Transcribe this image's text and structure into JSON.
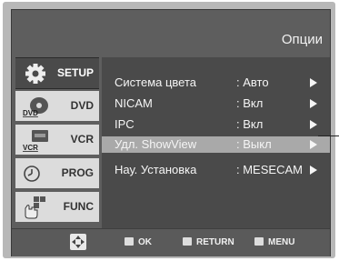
{
  "header": {
    "title": "Опции"
  },
  "sidebar": {
    "items": [
      {
        "label": "SETUP",
        "icon": "gear-icon",
        "active": true
      },
      {
        "label": "DVD",
        "icon": "dvd-disc-icon",
        "icon_text": "DVD"
      },
      {
        "label": "VCR",
        "icon": "vcr-cassette-icon",
        "icon_text": "VCR"
      },
      {
        "label": "PROG",
        "icon": "clock-icon"
      },
      {
        "label": "FUNC",
        "icon": "hand-pointer-icon"
      }
    ]
  },
  "menu": {
    "rows": [
      {
        "name": "Система цвета",
        "value": ": Авто"
      },
      {
        "name": "NICAM",
        "value": ": Вкл"
      },
      {
        "name": "IPC",
        "value": ": Вкл"
      },
      {
        "name": "Удл. ShowView",
        "value": ": Выкл",
        "selected": true
      },
      {
        "name": "Нау. Установка",
        "value": ": MESECAM"
      }
    ]
  },
  "footer": {
    "nav_icon": "dpad-icon",
    "ok_label": "OK",
    "return_label": "RETURN",
    "menu_label": "MENU"
  },
  "colors": {
    "screen_bg": "#505050",
    "selected_row": "#a9a9a9",
    "frame": "#b8b8b8",
    "tab_inactive": "#dcdcdc"
  }
}
